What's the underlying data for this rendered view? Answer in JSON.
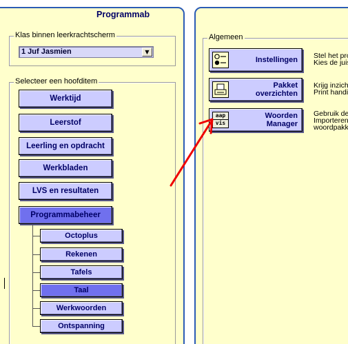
{
  "left": {
    "class_group_label": "Klas binnen leerkrachtscherm",
    "class_select_value": "1 Juf Jasmien",
    "main_group_label": "Selecteer een hoofditem",
    "main_items": [
      {
        "label": "Werktijd",
        "active": false
      },
      {
        "label": "Leerstof",
        "active": false
      },
      {
        "label": "Leerling en opdracht",
        "active": false
      },
      {
        "label": "Werkbladen",
        "active": false
      },
      {
        "label": "LVS en resultaten",
        "active": false
      },
      {
        "label": "Programmabeheer",
        "active": true
      }
    ],
    "sub_items": [
      {
        "label": "Octoplus",
        "active": false
      },
      {
        "label": "Rekenen",
        "active": false
      },
      {
        "label": "Tafels",
        "active": false
      },
      {
        "label": "Taal",
        "active": true
      },
      {
        "label": "Werkwoorden",
        "active": false
      },
      {
        "label": "Ontspanning",
        "active": false
      }
    ]
  },
  "right": {
    "title": "Programmab",
    "group_label": "Algemeen",
    "items": [
      {
        "label1": "Instellingen",
        "label2": "",
        "desc1": "Stel het pro",
        "desc2": "Kies de juis",
        "desc3": "",
        "icon": "settings-icon"
      },
      {
        "label1": "Pakket",
        "label2": "overzichten",
        "desc1": "Krijg inzich",
        "desc2": "Print handi",
        "desc3": "",
        "icon": "printer-icon"
      },
      {
        "label1": "Woorden",
        "label2": "Manager",
        "desc1": "Gebruik de",
        "desc2": "Importeren",
        "desc3": "woordpakk",
        "icon": "word-cards-icon",
        "icon_text1": "aap",
        "icon_text2": "vis"
      }
    ]
  },
  "colors": {
    "panel_bg": "#ffffcc",
    "panel_border": "#2a5bb5",
    "button_bg": "#ccccff",
    "button_active": "#7070ee",
    "button_text": "#000066",
    "arrow": "#ee0000"
  }
}
